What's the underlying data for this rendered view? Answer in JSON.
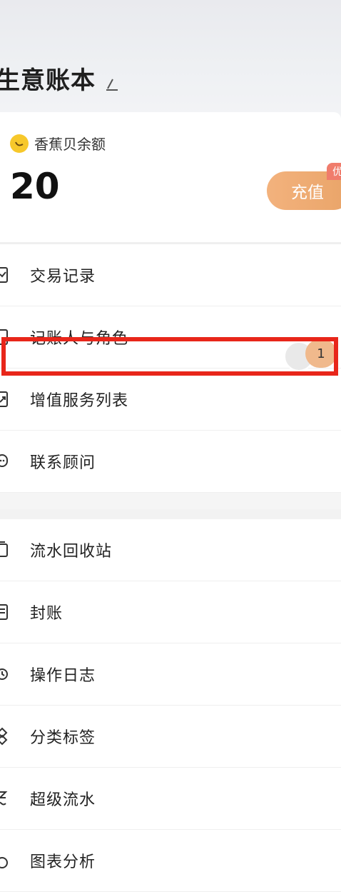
{
  "header": {
    "title": "生意账本",
    "edit_icon": "edit-pen-icon"
  },
  "balance": {
    "label": "香蕉贝余额",
    "icon": "banana-icon",
    "value": "20",
    "recharge_label": "充值",
    "promo_badge": "优"
  },
  "menu_section_1": [
    {
      "label": "交易记录",
      "icon": "clipboard-icon"
    },
    {
      "label": "记账人与角色",
      "icon": "person-icon",
      "count": "1"
    },
    {
      "label": "增值服务列表",
      "icon": "external-link-icon"
    },
    {
      "label": "联系顾问",
      "icon": "chat-bubble-icon"
    }
  ],
  "menu_section_2": [
    {
      "label": "流水回收站",
      "icon": "recycle-bin-icon"
    },
    {
      "label": "封账",
      "icon": "ledger-lock-icon"
    },
    {
      "label": "操作日志",
      "icon": "log-icon"
    },
    {
      "label": "分类标签",
      "icon": "tags-icon"
    },
    {
      "label": "超级流水",
      "icon": "wave-icon"
    },
    {
      "label": "图表分析",
      "icon": "chart-icon"
    }
  ],
  "colors": {
    "accent": "#e9a468",
    "highlight": "#e8261a",
    "promo": "#f07c6c"
  }
}
